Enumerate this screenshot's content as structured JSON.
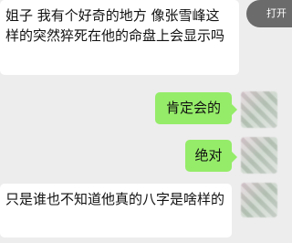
{
  "top_right_button": {
    "label": "打开"
  },
  "messages": [
    {
      "side": "received",
      "text": "姐子 我有个好奇的地方 像张雪峰这样的突然猝死在他的命盘上会显示吗"
    },
    {
      "side": "sent",
      "text": "肯定会的"
    },
    {
      "side": "sent",
      "text": "绝对"
    },
    {
      "side": "received",
      "text": "只是谁也不知道他真的八字是啥样的"
    }
  ],
  "colors": {
    "background": "#ededed",
    "received_bubble": "#ffffff",
    "sent_bubble": "#95ec69",
    "text": "#111111"
  }
}
